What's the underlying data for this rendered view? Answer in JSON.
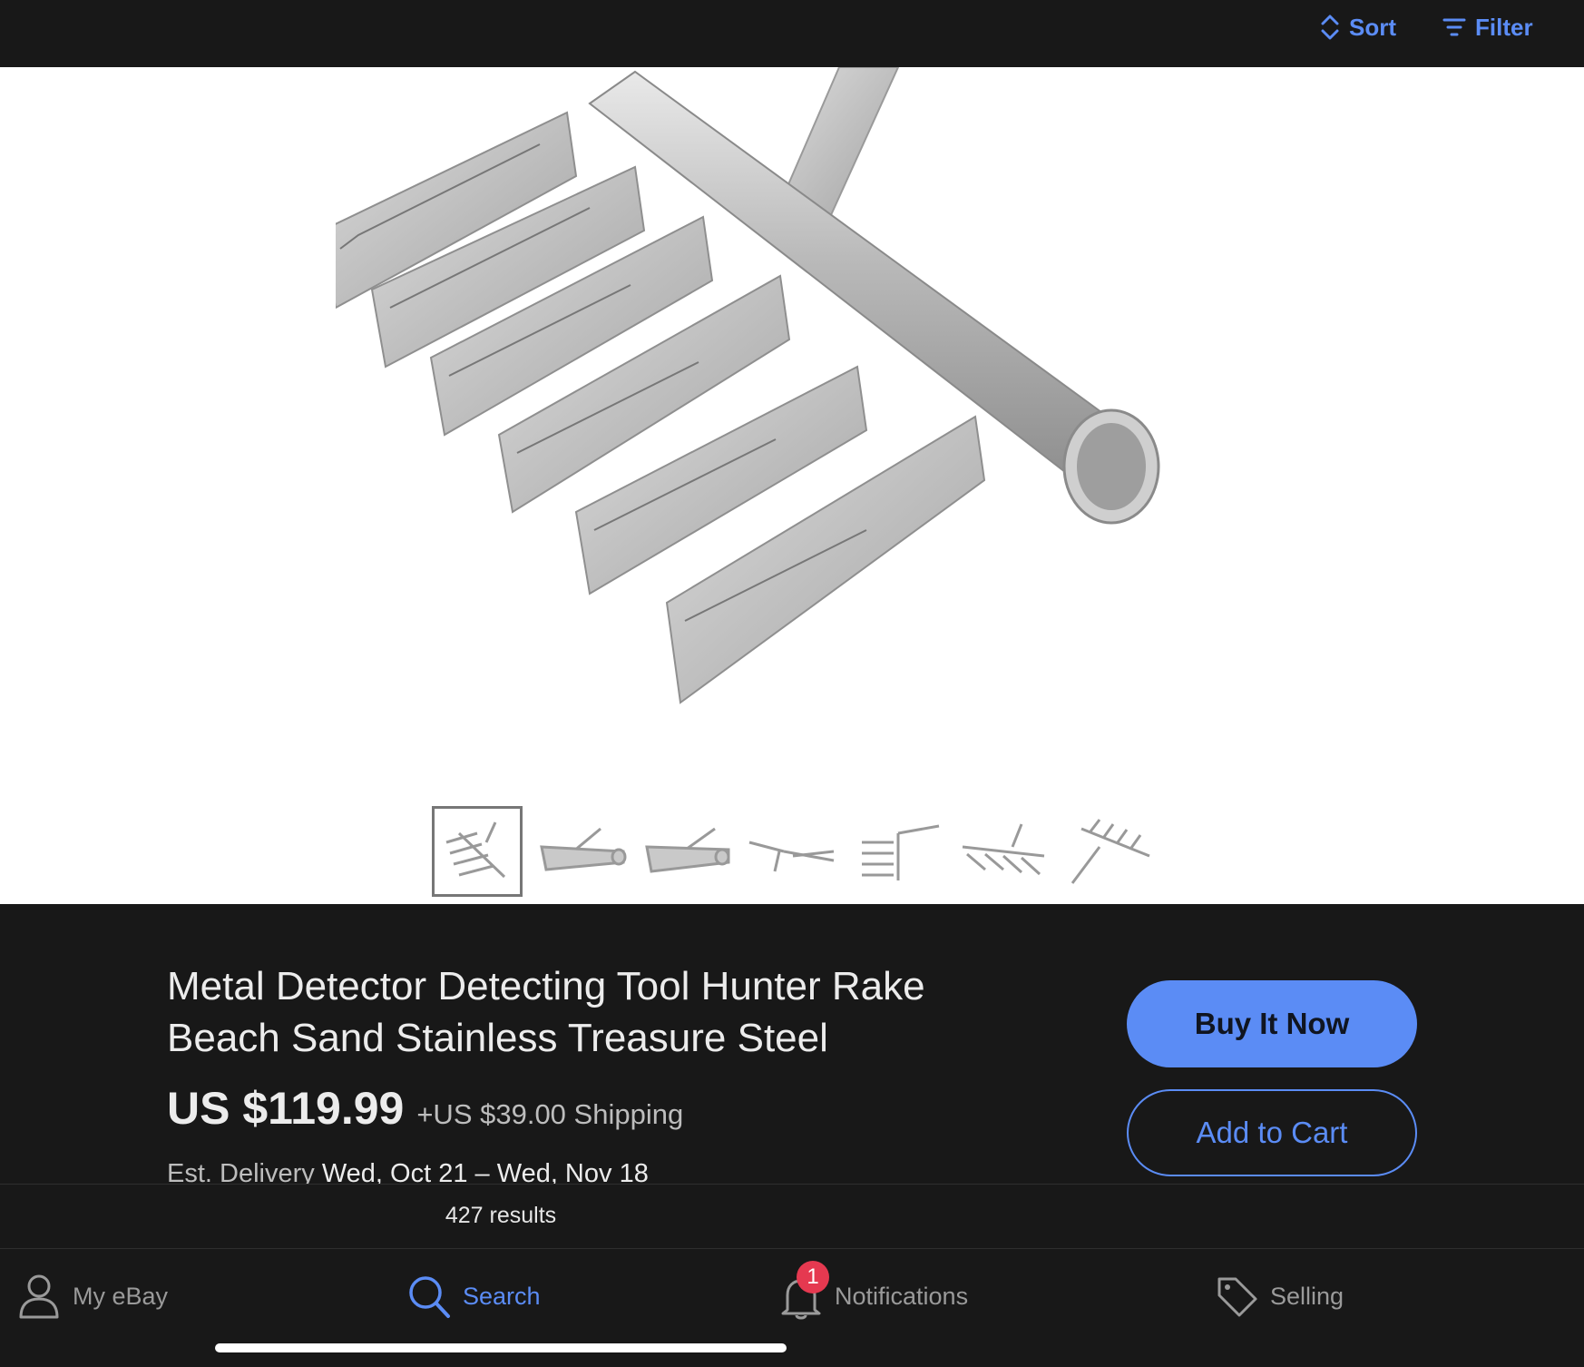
{
  "topbar": {
    "sort_label": "Sort",
    "filter_label": "Filter"
  },
  "gallery": {
    "thumbnail_count": 7,
    "selected_index": 0
  },
  "product": {
    "title": "Metal Detector Detecting Tool Hunter Rake Beach Sand Stainless Treasure Steel",
    "price": "US $119.99",
    "shipping": "+US $39.00 Shipping",
    "delivery_label": "Est. Delivery",
    "delivery_dates": "Wed, Oct 21 – Wed, Nov 18",
    "buy_now_label": "Buy It Now",
    "add_to_cart_label": "Add to Cart"
  },
  "results": {
    "count_text": "427 results"
  },
  "tabbar": {
    "my_ebay": "My eBay",
    "search": "Search",
    "notifications": "Notifications",
    "notifications_badge": "1",
    "selling": "Selling"
  },
  "colors": {
    "accent": "#5b8cf5",
    "background": "#181818",
    "badge": "#e53950"
  }
}
